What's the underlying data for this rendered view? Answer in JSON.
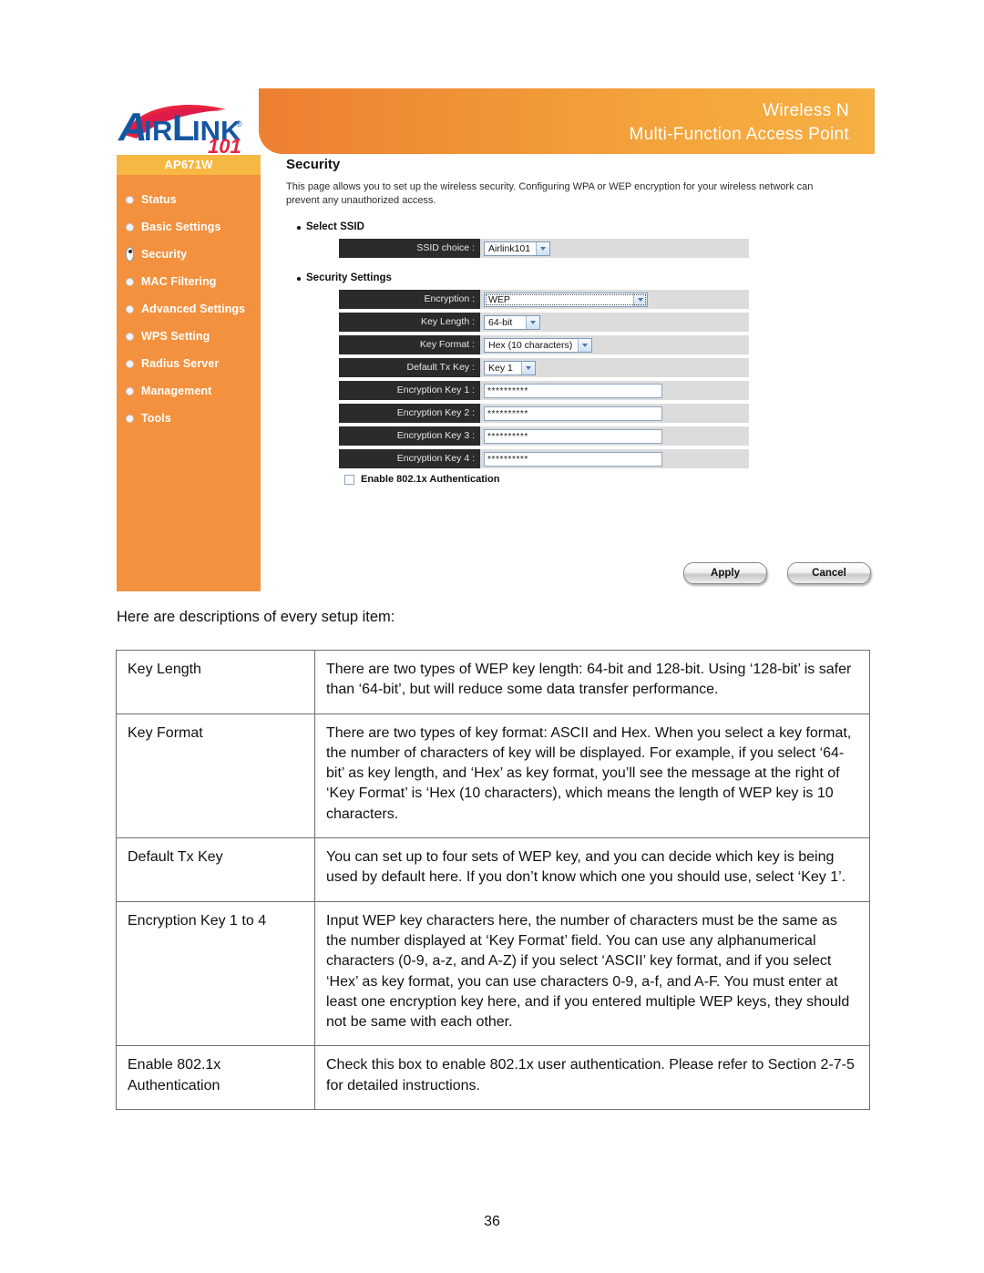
{
  "device_ui": {
    "brand": {
      "name": "AIRLINK",
      "suffix": "101",
      "registered_mark": "®"
    },
    "header": {
      "line1": "Wireless N",
      "line2": "Multi-Function Access Point",
      "gradient_start": "#ed7f31",
      "gradient_end": "#f6b044"
    },
    "sidebar": {
      "model": "AP671W",
      "model_bar_color": "#f7b843",
      "background_color": "#f3913f",
      "items": [
        {
          "label": "Status",
          "selected": false
        },
        {
          "label": "Basic Settings",
          "selected": false
        },
        {
          "label": "Security",
          "selected": true
        },
        {
          "label": "MAC Filtering",
          "selected": false
        },
        {
          "label": "Advanced Settings",
          "selected": false
        },
        {
          "label": "WPS Setting",
          "selected": false
        },
        {
          "label": "Radius Server",
          "selected": false
        },
        {
          "label": "Management",
          "selected": false
        },
        {
          "label": "Tools",
          "selected": false
        }
      ]
    },
    "main": {
      "title": "Security",
      "description": "This page allows you to set up the wireless security. Configuring WPA or WEP encryption for your wireless network can prevent any unauthorized access.",
      "section_select_ssid": {
        "heading": "Select SSID",
        "ssid_choice_label": "SSID choice :",
        "ssid_choice_value": "Airlink101"
      },
      "section_security_settings": {
        "heading": "Security Settings",
        "encryption_label": "Encryption :",
        "encryption_value": "WEP",
        "key_length_label": "Key Length :",
        "key_length_value": "64-bit",
        "key_format_label": "Key Format :",
        "key_format_value": "Hex (10 characters)",
        "default_tx_key_label": "Default Tx Key :",
        "default_tx_key_value": "Key 1",
        "encryption_key_1_label": "Encryption Key 1 :",
        "encryption_key_1_value": "**********",
        "encryption_key_2_label": "Encryption Key 2 :",
        "encryption_key_2_value": "**********",
        "encryption_key_3_label": "Encryption Key 3 :",
        "encryption_key_3_value": "**********",
        "encryption_key_4_label": "Encryption Key 4 :",
        "encryption_key_4_value": "**********",
        "enable_8021x_label": "Enable 802.1x Authentication",
        "enable_8021x_checked": false
      },
      "buttons": {
        "apply": "Apply",
        "cancel": "Cancel"
      }
    }
  },
  "document": {
    "intro": "Here are descriptions of every setup item:",
    "table": {
      "rows": [
        {
          "term": "Key Length",
          "description": "There are two types of WEP key length: 64-bit and 128-bit. Using ‘128-bit’ is safer than ‘64-bit’, but will reduce some data transfer performance."
        },
        {
          "term": "Key Format",
          "description": "There are two types of key format: ASCII and Hex. When you select a key format, the number of characters of key will be displayed. For example, if you select ‘64-bit’ as key length, and ‘Hex’ as key format, you’ll see the message at the right of ‘Key Format’ is ‘Hex (10 characters), which means the length of WEP key is 10 characters."
        },
        {
          "term": "Default Tx Key",
          "description": "You can set up to four sets of WEP key, and you can decide which key is being used by default here. If you don’t know which one you should use, select ‘Key 1’."
        },
        {
          "term": "Encryption Key 1 to 4",
          "description": "Input WEP key characters here, the number of characters must be the same as the number displayed at ‘Key Format’ field. You can use any alphanumerical characters (0-9, a-z, and A-Z) if you select ‘ASCII’ key format, and if you select ‘Hex’ as key format, you can use characters 0-9, a-f, and A-F. You must enter at least one encryption key here, and if you entered multiple WEP keys, they should not be same with each other."
        },
        {
          "term": "Enable 802.1x\nAuthentication",
          "description": "Check this box to enable 802.1x user authentication. Please refer to Section 2-7-5 for detailed instructions."
        }
      ]
    },
    "page_number": "36"
  }
}
